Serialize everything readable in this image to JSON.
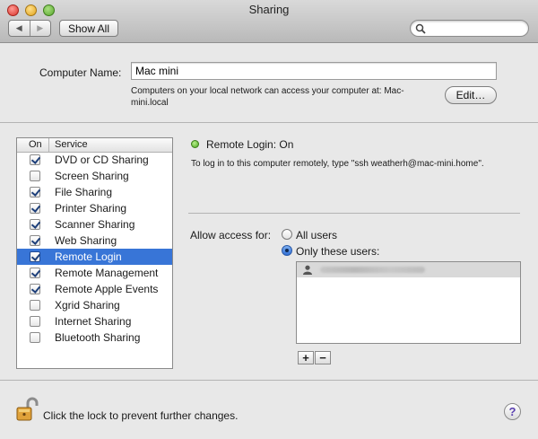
{
  "window": {
    "title": "Sharing"
  },
  "toolbar": {
    "back_glyph": "◀",
    "forward_glyph": "▶",
    "show_all_label": "Show All",
    "search_placeholder": ""
  },
  "computer_name": {
    "label": "Computer Name:",
    "value": "Mac mini",
    "description": "Computers on your local network can access your computer at: Mac-mini.local",
    "edit_label": "Edit…"
  },
  "service_list": {
    "header_on": "On",
    "header_service": "Service",
    "selected_index": 6,
    "items": [
      {
        "label": "DVD or CD Sharing",
        "checked": true
      },
      {
        "label": "Screen Sharing",
        "checked": false
      },
      {
        "label": "File Sharing",
        "checked": true
      },
      {
        "label": "Printer Sharing",
        "checked": true
      },
      {
        "label": "Scanner Sharing",
        "checked": true
      },
      {
        "label": "Web Sharing",
        "checked": true
      },
      {
        "label": "Remote Login",
        "checked": true
      },
      {
        "label": "Remote Management",
        "checked": true
      },
      {
        "label": "Remote Apple Events",
        "checked": true
      },
      {
        "label": "Xgrid Sharing",
        "checked": false
      },
      {
        "label": "Internet Sharing",
        "checked": false
      },
      {
        "label": "Bluetooth Sharing",
        "checked": false
      }
    ]
  },
  "detail": {
    "status_title": "Remote Login: On",
    "status_color": "#4ca71f",
    "status_description": "To log in to this computer remotely, type \"ssh weatherh@mac-mini.home\".",
    "allow_access_label": "Allow access for:",
    "option_all_users": "All users",
    "option_only_these": "Only these users:",
    "selected_option": "only_these",
    "add_label": "+",
    "remove_label": "−"
  },
  "footer": {
    "lock_text": "Click the lock to prevent further changes.",
    "help_glyph": "?"
  },
  "colors": {
    "selection": "#3875d7"
  }
}
